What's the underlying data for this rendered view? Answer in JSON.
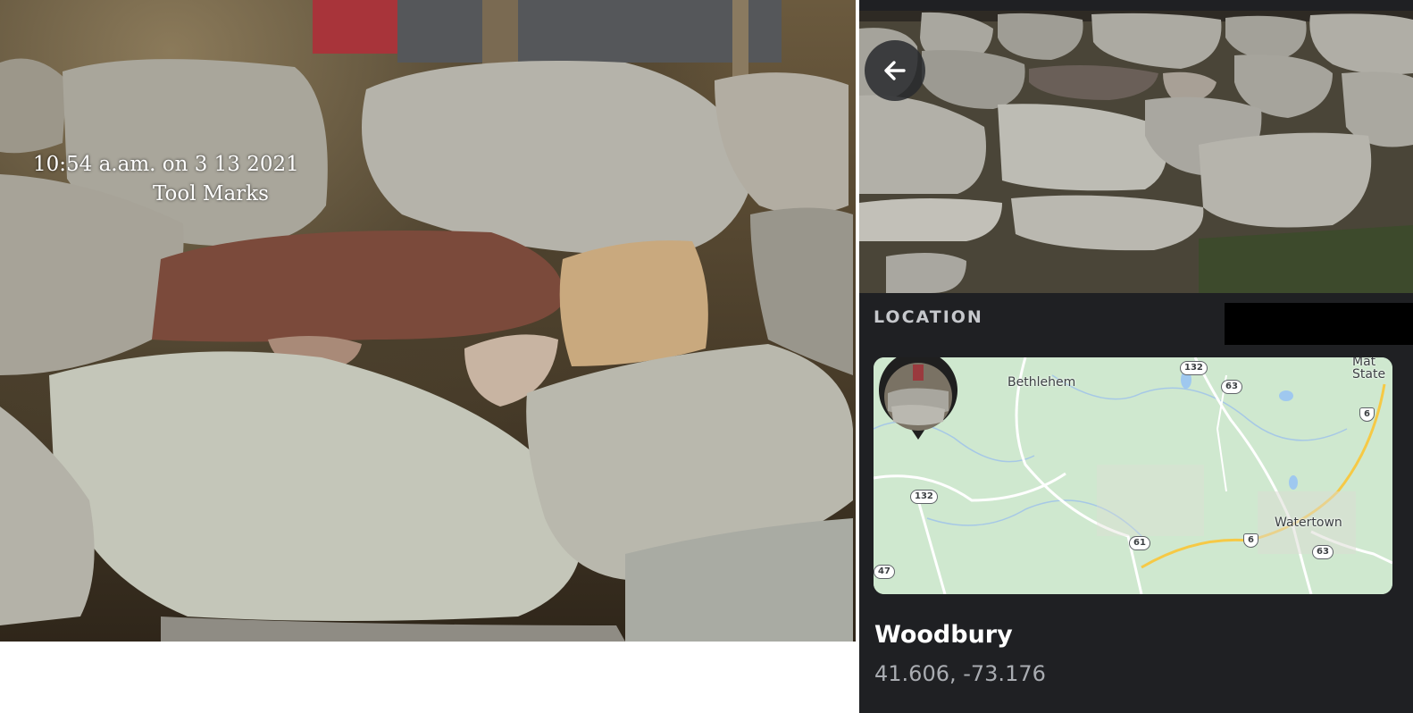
{
  "left_photo": {
    "timestamp_text": "10:54 a.am. on 3 13 2021",
    "caption_text": "Tool Marks"
  },
  "panel": {
    "back_icon": "arrow-left-icon",
    "section_label": "LOCATION",
    "map": {
      "labels": {
        "bethlehem": "Bethlehem",
        "watertown": "Watertown",
        "state": "Mat\nState"
      },
      "shields": {
        "r132_top": "132",
        "r63_top": "63",
        "r6_right": "6",
        "r132_left": "132",
        "r61": "61",
        "r6_mid": "6",
        "r63_bottom": "63",
        "r47": "47"
      }
    },
    "place_name": "Woodbury",
    "coordinates": "41.606, -73.176"
  },
  "colors": {
    "panel_bg": "#1f2023",
    "map_land": "#cfe8cf",
    "highway": "#f6c945"
  }
}
